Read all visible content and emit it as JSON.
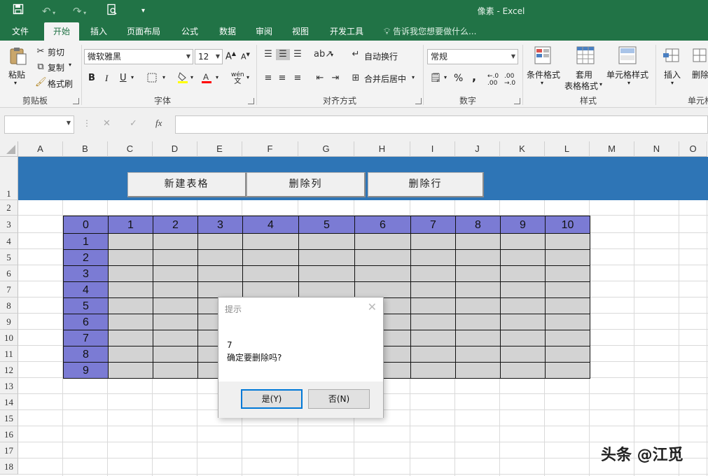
{
  "app": {
    "title": "像素 - Excel"
  },
  "colors": {
    "accent": "#217346",
    "banner": "#2e75b6",
    "table_header": "#7b7bd4",
    "table_body": "#d3d3d3"
  },
  "quick_access": {
    "save_icon": "save-icon",
    "undo_icon": "undo-icon",
    "redo_icon": "redo-icon",
    "print_preview_icon": "print-preview-icon",
    "customize_icon": "customize-icon"
  },
  "tabs": [
    "文件",
    "开始",
    "插入",
    "页面布局",
    "公式",
    "数据",
    "审阅",
    "视图",
    "开发工具"
  ],
  "active_tab": "开始",
  "tell_me": "告诉我您想要做什么...",
  "ribbon": {
    "clipboard": {
      "paste": "粘贴",
      "cut": "剪切",
      "copy": "复制",
      "format_painter": "格式刷",
      "label": "剪贴板"
    },
    "font": {
      "name": "微软雅黑",
      "size": "12",
      "bold": "B",
      "italic": "I",
      "underline": "U",
      "grow": "A",
      "shrink": "A",
      "phonetic": "wén",
      "label": "字体"
    },
    "alignment": {
      "wrap_text": "自动换行",
      "merge_center": "合并后居中",
      "label": "对齐方式"
    },
    "number": {
      "format": "常规",
      "percent": "%",
      "comma": ",",
      "label": "数字"
    },
    "styles": {
      "conditional_format": "条件格式",
      "format_table_1": "套用",
      "format_table_2": "表格格式",
      "cell_styles": "单元格样式",
      "label": "样式"
    },
    "cells": {
      "insert": "插入",
      "delete": "删除",
      "label": "单元格"
    }
  },
  "formula_bar": {
    "name_box": "",
    "cancel": "✕",
    "enter": "✓",
    "fx": "fx",
    "value": ""
  },
  "columns": [
    "A",
    "B",
    "C",
    "D",
    "E",
    "F",
    "G",
    "H",
    "I",
    "J",
    "K",
    "L",
    "M",
    "N",
    "O"
  ],
  "rows": [
    "1",
    "2",
    "3",
    "4",
    "5",
    "6",
    "7",
    "8",
    "9",
    "10",
    "11",
    "12",
    "13",
    "14",
    "15",
    "16",
    "17",
    "18"
  ],
  "sheet_buttons": {
    "new_table": "新建表格",
    "delete_column": "删除列",
    "delete_row": "删除行"
  },
  "table": {
    "header": [
      "0",
      "1",
      "2",
      "3",
      "4",
      "5",
      "6",
      "7",
      "8",
      "9",
      "10"
    ],
    "row_labels": [
      "1",
      "2",
      "3",
      "4",
      "5",
      "6",
      "7",
      "8",
      "9"
    ]
  },
  "dialog": {
    "title": "提示",
    "message_line1": "7",
    "message_line2": "确定要删除吗?",
    "yes": "是(Y)",
    "no": "否(N)"
  },
  "watermark": "头条 @江觅"
}
